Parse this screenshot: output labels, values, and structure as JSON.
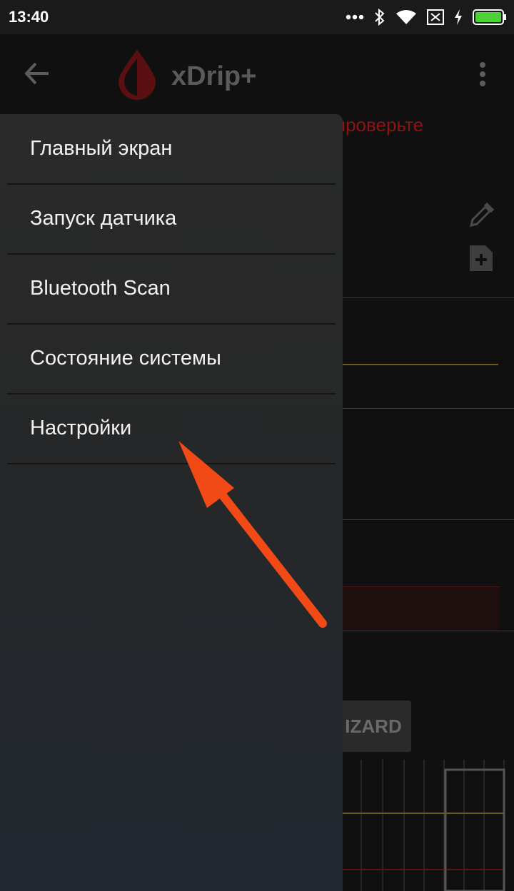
{
  "status_bar": {
    "time": "13:40",
    "icons": [
      "more-dots-icon",
      "bluetooth-icon",
      "wifi-icon",
      "sim-disabled-icon",
      "charging-icon",
      "battery-icon"
    ]
  },
  "app_bar": {
    "title": "xDrip+",
    "icons": [
      "back-arrow-icon",
      "blood-drop-logo",
      "overflow-menu-icon"
    ]
  },
  "background": {
    "alert_text": "проверьте",
    "wizard_label": "IZARD"
  },
  "drawer": {
    "items": [
      {
        "label": "Главный экран"
      },
      {
        "label": "Запуск датчика"
      },
      {
        "label": "Bluetooth Scan"
      },
      {
        "label": "Состояние системы"
      },
      {
        "label": "Настройки"
      }
    ]
  },
  "annotation": {
    "arrow_color": "#f24a16",
    "points_to": "Настройки"
  },
  "colors": {
    "accent_red": "#b01c1c",
    "alert_red": "#8e1414",
    "battery_green": "#4cd137"
  }
}
